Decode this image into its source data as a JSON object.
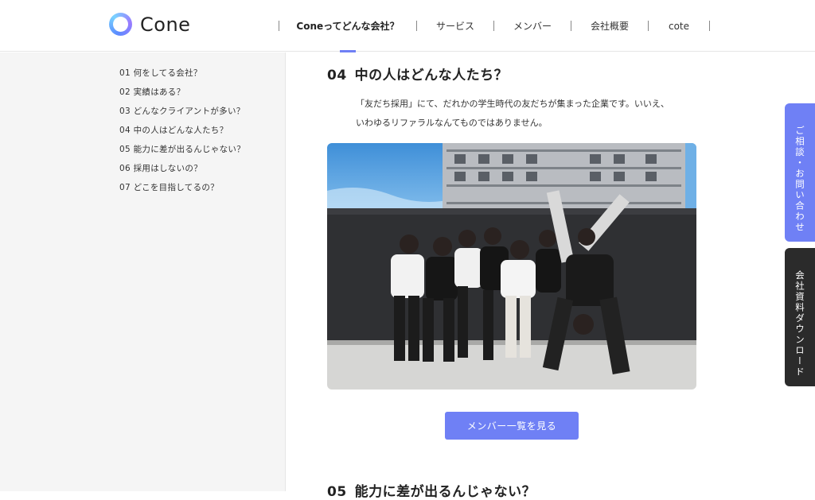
{
  "brand": {
    "name": "Cone"
  },
  "nav": {
    "items": [
      {
        "label": "Coneってどんな会社？",
        "active": true
      },
      {
        "label": "サービス"
      },
      {
        "label": "メンバー"
      },
      {
        "label": "会社概要"
      },
      {
        "label": "cote"
      }
    ]
  },
  "toc": [
    "01 何をしてる会社？",
    "02 実績はある？",
    "03 どんなクライアントが多い？",
    "04 中の人はどんな人たち？",
    "05 能力に差が出るんじゃない？",
    "06 採用はしないの？",
    "07 どこを目指してるの？"
  ],
  "section": {
    "num": "04",
    "title": "中の人はどんな人たち？",
    "body_line1": "「友だち採用」にて、だれかの学生時代の友だちが集まった企業です。いいえ、",
    "body_line2": "いわゆるリファラルなんてものではありません。",
    "cta_label": "メンバー一覧を見る"
  },
  "next_section": {
    "num": "05",
    "title": "能力に差が出るんじゃない？"
  },
  "side_tabs": {
    "consult": "ご相談・お問い合わせ",
    "download": "会社資料ダウンロード"
  },
  "colors": {
    "accent": "#6f80f5",
    "dark": "#2b2b2b",
    "sidebar_bg": "#f5f5f5"
  }
}
